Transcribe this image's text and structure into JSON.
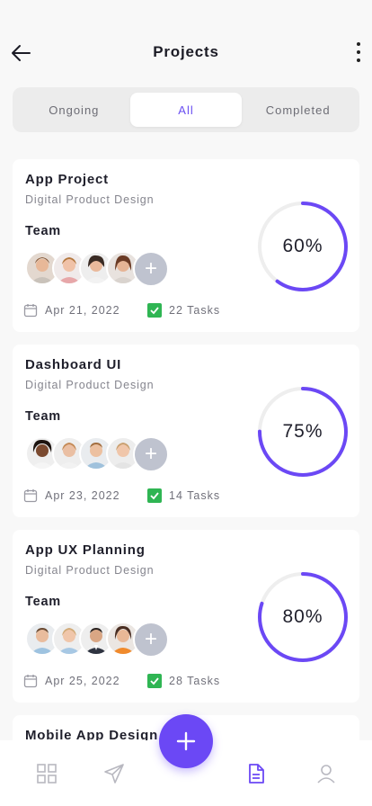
{
  "header": {
    "title": "Projects"
  },
  "tabs": [
    {
      "label": "Ongoing",
      "active": false
    },
    {
      "label": "All",
      "active": true
    },
    {
      "label": "Completed",
      "active": false
    }
  ],
  "projects": [
    {
      "title": "App Project",
      "subtitle": "Digital Product Design",
      "team_label": "Team",
      "date": "Apr 21, 2022",
      "tasks": "22 Tasks",
      "progress_label": "60%",
      "progress": 0.6
    },
    {
      "title": "Dashboard UI",
      "subtitle": "Digital Product Design",
      "team_label": "Team",
      "date": "Apr 23, 2022",
      "tasks": "14 Tasks",
      "progress_label": "75%",
      "progress": 0.75
    },
    {
      "title": "App UX Planning",
      "subtitle": "Digital Product Design",
      "team_label": "Team",
      "date": "Apr 25, 2022",
      "tasks": "28 Tasks",
      "progress_label": "80%",
      "progress": 0.8
    },
    {
      "title": "Mobile App Design"
    }
  ],
  "colors": {
    "accent": "#6b48f5",
    "check": "#2fb553",
    "track": "#eeeeee"
  },
  "icons": {
    "back": "arrow-left-icon",
    "more": "more-vertical-icon",
    "date": "calendar-icon",
    "tasks": "checkbox-icon",
    "add_member": "plus-icon",
    "fab": "plus-icon",
    "nav": [
      "grid-icon",
      "send-icon",
      "document-icon",
      "user-icon"
    ]
  }
}
